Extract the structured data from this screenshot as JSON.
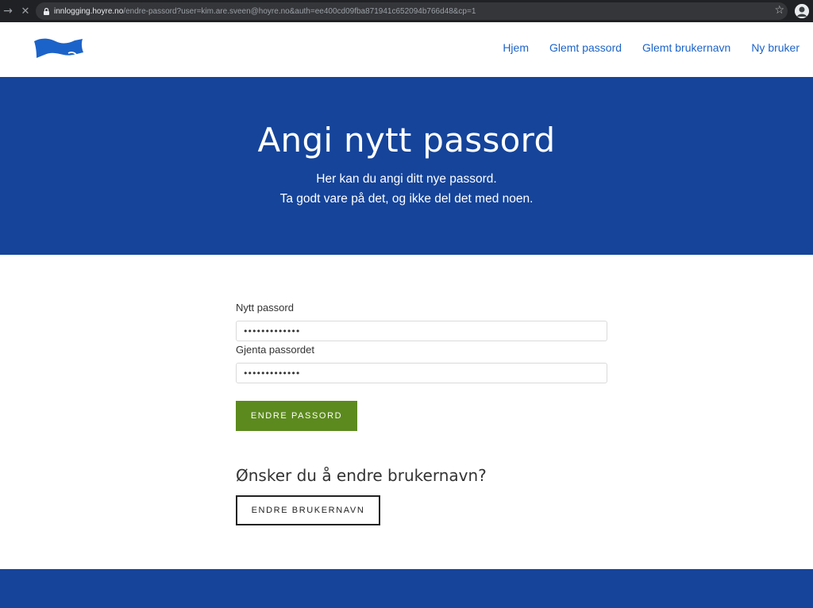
{
  "browser": {
    "url_host": "innlogging.hoyre.no",
    "url_rest": "/endre-passord?user=kim.are.sveen@hoyre.no&auth=ee400cd09fba871941c652094b766d48&cp=1",
    "forward_icon": "→",
    "stop_icon": "✕",
    "star_icon": "☆"
  },
  "header": {
    "nav": [
      {
        "label": "Hjem"
      },
      {
        "label": "Glemt passord"
      },
      {
        "label": "Glemt brukernavn"
      },
      {
        "label": "Ny bruker"
      }
    ]
  },
  "hero": {
    "title": "Angi nytt passord",
    "line1": "Her kan du angi ditt nye passord.",
    "line2": "Ta godt vare på det, og ikke del det med noen."
  },
  "form": {
    "new_password_label": "Nytt passord",
    "new_password_value": "•••••••••••••",
    "repeat_password_label": "Gjenta passordet",
    "repeat_password_value": "•••••••••••••",
    "submit_label": "ENDRE PASSORD"
  },
  "username_section": {
    "heading": "Ønsker du å endre brukernavn?",
    "button_label": "ENDRE BRUKERNAVN"
  },
  "colors": {
    "brand_blue": "#15449a",
    "link_blue": "#1c63c9",
    "primary_green": "#5c8a1e"
  }
}
